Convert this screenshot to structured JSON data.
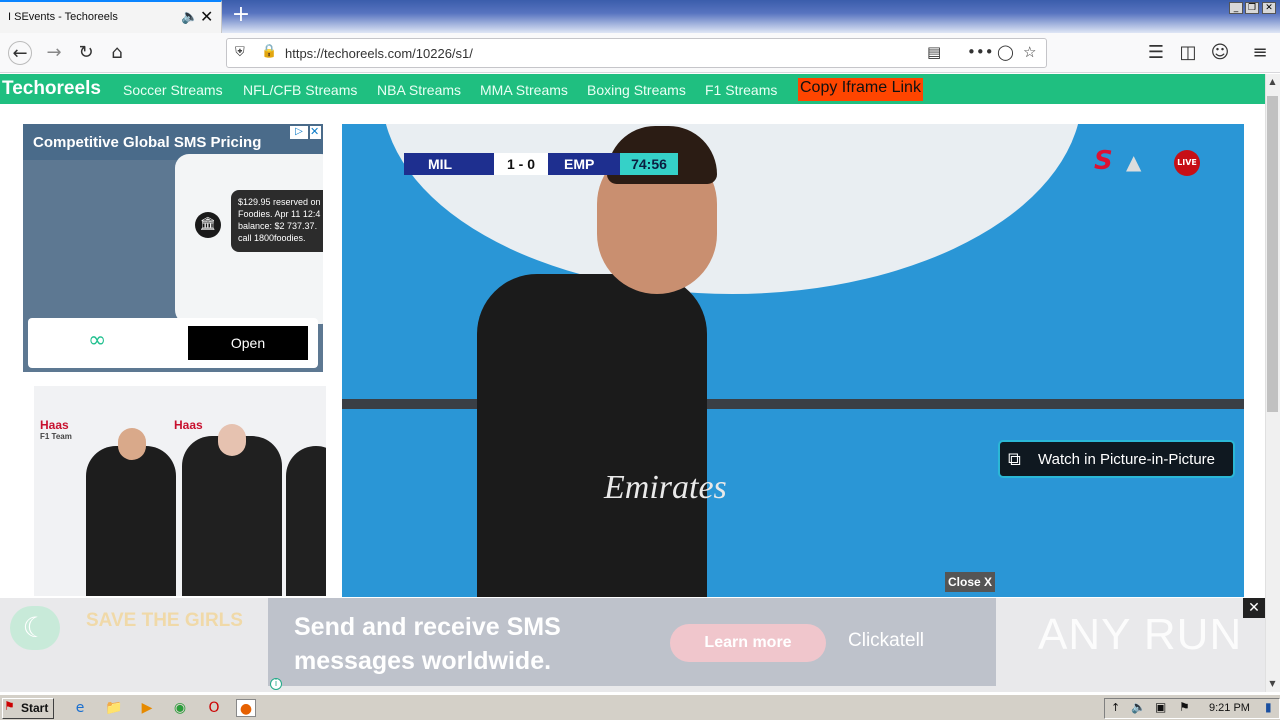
{
  "browser": {
    "tab_title": "I SEvents - Techoreels",
    "url": "https://techoreels.com/10226/s1/",
    "icons": [
      "back-icon",
      "forward-icon",
      "reload-icon",
      "home-icon",
      "shield-icon",
      "lock-icon",
      "reader-icon",
      "more-icon",
      "pocket-icon",
      "star-icon",
      "library-icon",
      "sidebar-icon",
      "account-icon",
      "menu-icon"
    ]
  },
  "site": {
    "brand": "Techoreels",
    "nav": [
      "Soccer Streams",
      "NFL/CFB Streams",
      "NBA Streams",
      "MMA Streams",
      "Boxing Streams",
      "F1 Streams"
    ],
    "copy_link": "Copy Iframe Link"
  },
  "ad_left": {
    "title": "Competitive Global SMS Pricing",
    "sms_text": "$129.95 reserved on Foodies. Apr 11 12:4 balance: $2 737.37. call 1800foodies.",
    "open_label": "Open"
  },
  "f1_image": {
    "brand": "Haas",
    "subtitle": "F1 Team"
  },
  "video": {
    "home": "MIL",
    "score": "1 - 0",
    "away": "EMP",
    "time": "74:56",
    "live": "LIVE",
    "jersey_sponsor": "Emirates",
    "pip_label": "Watch in Picture-in-Picture",
    "close_label": "Close X"
  },
  "bottom_ad": {
    "left_text": "SAVE THE GIRLS",
    "headline": "Send and receive SMS messages worldwide.",
    "button": "Learn more",
    "brand": "Clickatell"
  },
  "watermark": "ANY RUN",
  "taskbar": {
    "start": "Start",
    "clock": "9:21 PM"
  },
  "colors": {
    "site_header": "#1fbf80",
    "copy_link_bg": "#ff4500",
    "video_bg": "#2a96d6"
  }
}
